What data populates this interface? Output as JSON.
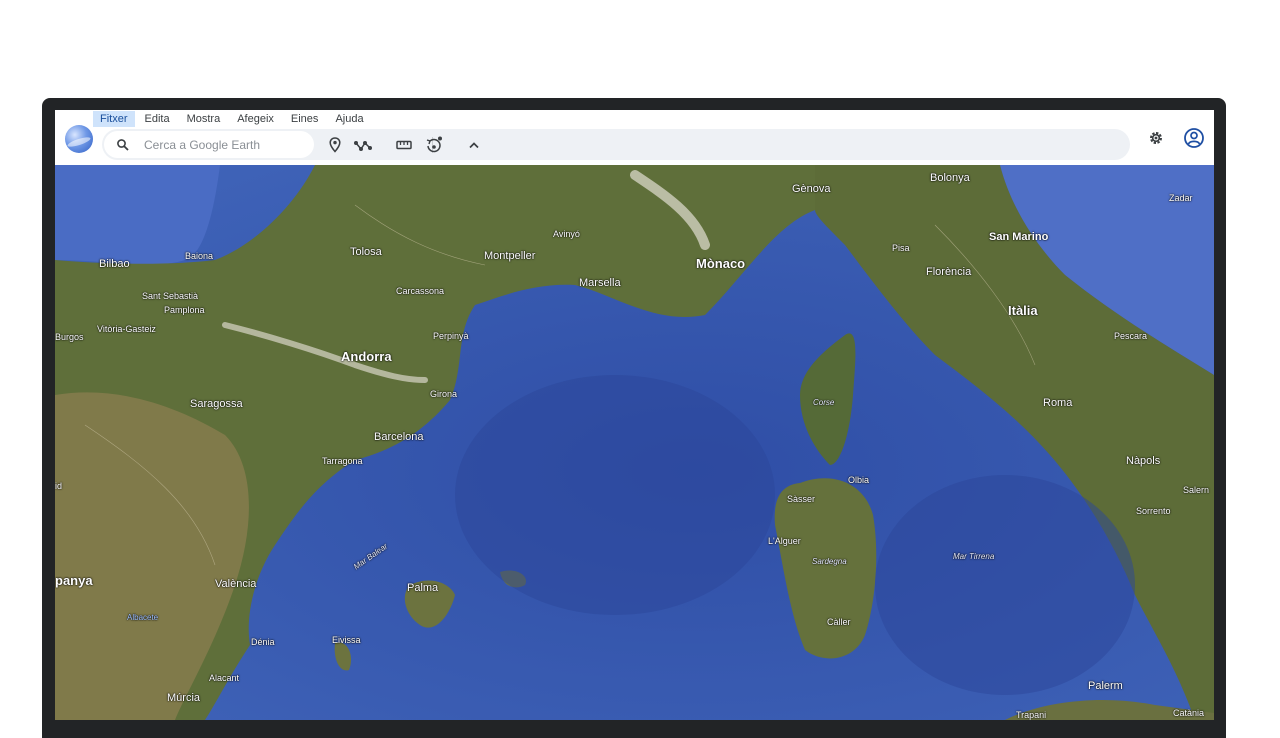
{
  "menu": {
    "items": [
      "Fitxer",
      "Edita",
      "Mostra",
      "Afegeix",
      "Eines",
      "Ajuda"
    ],
    "active": "Fitxer"
  },
  "search": {
    "placeholder": "Cerca a Google Earth"
  },
  "toolbar": {
    "icons": [
      "pin-icon",
      "path-icon",
      "ruler-icon",
      "history-icon",
      "collapse-icon"
    ]
  },
  "header_right": {
    "icons": [
      "settings-icon",
      "account-icon"
    ]
  },
  "map": {
    "labels": {
      "bilbao": "Bilbao",
      "baiona": "Baiona",
      "sant_sebastia": "Sant Sebastià",
      "pamplona": "Pamplona",
      "vitoria": "Vitòria-Gasteiz",
      "burgos": "Burgos",
      "tolosa": "Tolosa",
      "montpeller": "Montpeller",
      "avinyo": "Avinyó",
      "carcassona": "Carcassona",
      "marsella": "Marsella",
      "monaco": "Mònaco",
      "genova": "Gènova",
      "bolonya": "Bolonya",
      "san_marino": "San Marino",
      "zadar": "Zadar",
      "pisa": "Pisa",
      "florencia": "Florència",
      "italia": "Itàlia",
      "pescara": "Pescara",
      "roma": "Roma",
      "napols": "Nàpols",
      "salern": "Salern",
      "sorrento": "Sorrento",
      "andorra": "Andorra",
      "perpinya": "Perpinyà",
      "girona": "Girona",
      "saragossa": "Saragossa",
      "barcelona": "Barcelona",
      "tarragona": "Tarragona",
      "corse": "Corse",
      "olbia": "Olbia",
      "sasser": "Sàsser",
      "lalguer": "L'Alguer",
      "sardegna": "Sardegna",
      "caller": "Càller",
      "mar_tirrena": "Mar Tirrena",
      "mar_balear": "Mar Balear",
      "palma": "Palma",
      "eivissa": "Eivissa",
      "denia": "Dénia",
      "valencia": "València",
      "espanya": "panya",
      "albacete": "Albacete",
      "alacant": "Alacant",
      "murcia": "Múrcia",
      "palerm": "Palerm",
      "trapani": "Trapani",
      "catania": "Catània",
      "id": "id"
    }
  }
}
